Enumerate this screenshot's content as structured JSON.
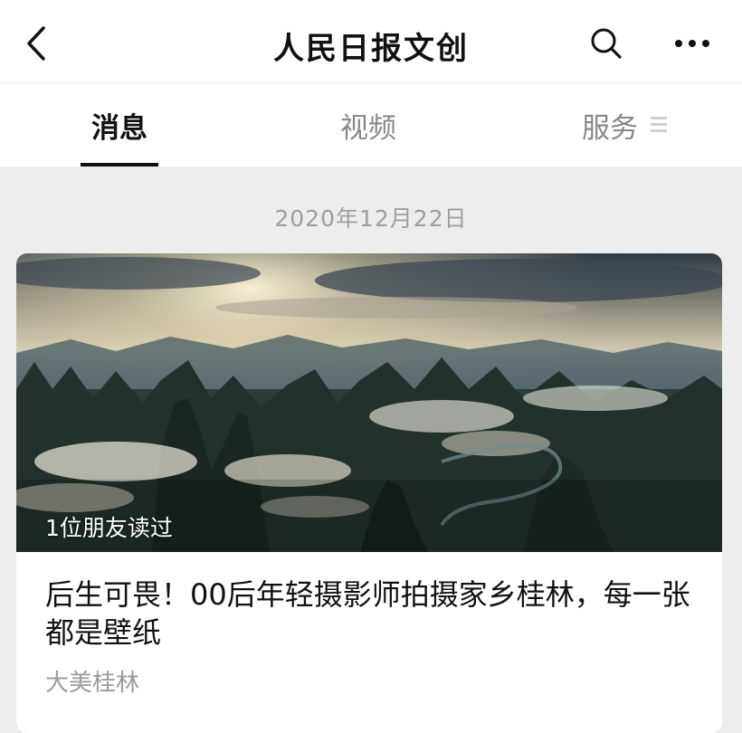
{
  "header": {
    "title": "人民日报文创",
    "icons": {
      "back": "back-chevron-icon",
      "search": "search-icon",
      "more": "more-dots-icon"
    }
  },
  "tabs": [
    {
      "label": "消息",
      "active": true
    },
    {
      "label": "视频",
      "active": false
    },
    {
      "label": "服务",
      "active": false,
      "icon": "menu-lines-icon"
    }
  ],
  "feed": {
    "date": "2020年12月22日",
    "articles": [
      {
        "cover_description_icon": "karst-mountain-landscape-photo",
        "read_by_friends": "1位朋友读过",
        "title": "后生可畏！00后年轻摄影师拍摄家乡桂林，每一张都是壁纸",
        "source": "大美桂林"
      }
    ]
  },
  "colors": {
    "background": "#ededed",
    "bar": "#ffffff",
    "text_primary": "#111111",
    "text_secondary": "#9a9a9a"
  }
}
